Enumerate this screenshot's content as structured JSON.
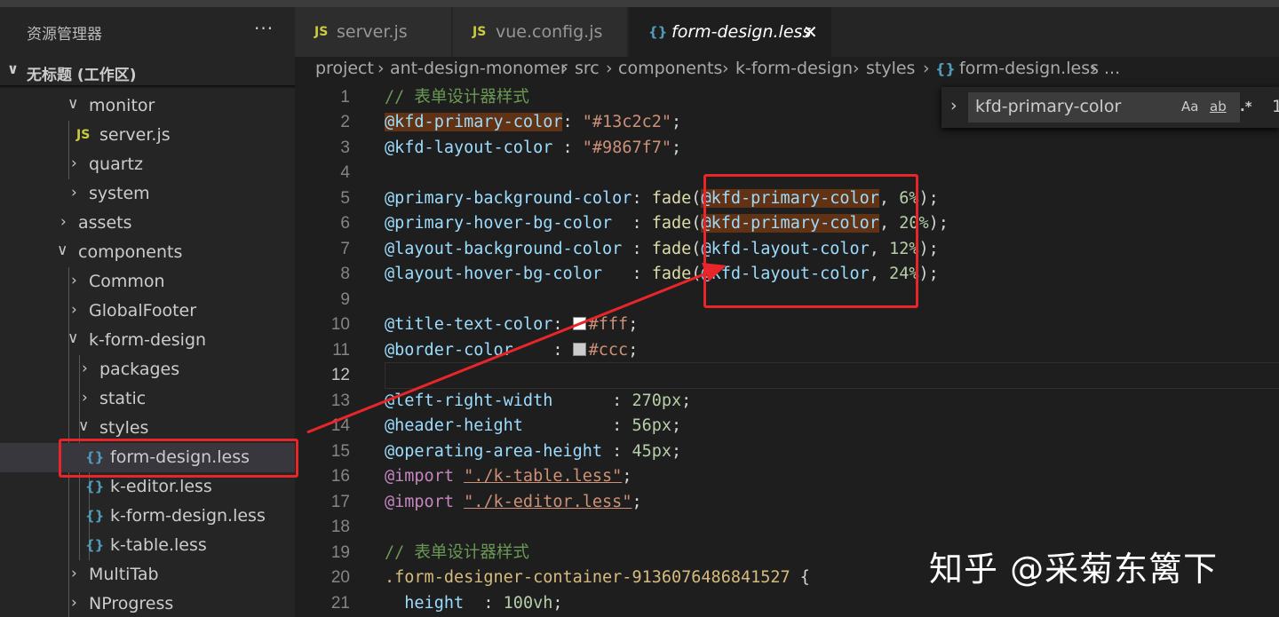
{
  "sidebar": {
    "header": "资源管理器",
    "more": "···",
    "workspace": "无标题 (工作区)",
    "items": [
      {
        "label": "monitor",
        "kind": "folder-open"
      },
      {
        "label": "server.js",
        "kind": "js"
      },
      {
        "label": "quartz",
        "kind": "folder"
      },
      {
        "label": "system",
        "kind": "folder"
      },
      {
        "label": "assets",
        "kind": "folder"
      },
      {
        "label": "components",
        "kind": "folder-open"
      },
      {
        "label": "Common",
        "kind": "folder"
      },
      {
        "label": "GlobalFooter",
        "kind": "folder"
      },
      {
        "label": "k-form-design",
        "kind": "folder-open"
      },
      {
        "label": "packages",
        "kind": "folder"
      },
      {
        "label": "static",
        "kind": "folder"
      },
      {
        "label": "styles",
        "kind": "folder-open"
      },
      {
        "label": "form-design.less",
        "kind": "less"
      },
      {
        "label": "k-editor.less",
        "kind": "less"
      },
      {
        "label": "k-form-design.less",
        "kind": "less"
      },
      {
        "label": "k-table.less",
        "kind": "less"
      },
      {
        "label": "MultiTab",
        "kind": "folder"
      },
      {
        "label": "NProgress",
        "kind": "folder"
      }
    ]
  },
  "icons": {
    "js": "JS",
    "less": "{}",
    "chevron_right": "›",
    "chevron_down": "⌄",
    "close": "✕"
  },
  "tabs": [
    {
      "label": "server.js",
      "icon": "JS"
    },
    {
      "label": "vue.config.js",
      "icon": "JS"
    },
    {
      "label": "form-design.less",
      "icon": "{}",
      "active": true
    }
  ],
  "breadcrumb": [
    "project",
    "ant-design-monomer",
    "src",
    "components",
    "k-form-design",
    "styles",
    "form-design.less",
    "..."
  ],
  "find": {
    "value": "kfd-primary-color",
    "match_case": "Aa",
    "whole_word": "ab",
    "regex": ".*",
    "count": "1"
  },
  "code_lines": [
    "1",
    "2",
    "3",
    "4",
    "5",
    "6",
    "7",
    "8",
    "9",
    "10",
    "11",
    "12",
    "13",
    "14",
    "15",
    "16",
    "17",
    "18",
    "19",
    "20",
    "21"
  ],
  "code": {
    "l1_comment": "// 表单设计器样式",
    "l2_var": "@kfd-primary-color",
    "l2_val": "\"#13c2c2\"",
    "l3_var": "@kfd-layout-color",
    "l3_val": "\"#9867f7\"",
    "l5_var": "@primary-background-color",
    "l6_var": "@primary-hover-bg-color",
    "l7_var": "@layout-background-color",
    "l8_var": "@layout-hover-bg-color",
    "fade": "fade",
    "kfd_primary": "@kfd-primary-color",
    "kfd_layout": "@kfd-layout-color",
    "p6": "6%",
    "p20": "20%",
    "p12": "12%",
    "p24": "24%",
    "l10_var": "@title-text-color",
    "l10_val": "#fff",
    "l11_var": "@border-color",
    "l11_val": "#ccc",
    "l13_var": "@left-right-width",
    "l13_val": "270px",
    "l14_var": "@header-height",
    "l14_val": "56px",
    "l15_var": "@operating-area-height",
    "l15_val": "45px",
    "import": "@import",
    "l16_path": "\"./k-table.less\"",
    "l17_path": "\"./k-editor.less\"",
    "l19_comment": "// 表单设计器样式",
    "l20_class": ".form-designer-container-9136076486841527",
    "l21_prop": "height",
    "l21_val": "100vh"
  },
  "swatch_colors": {
    "fff": "#ffffff",
    "ccc": "#cccccc"
  },
  "annotation_color": "#e8262a",
  "watermark": "知乎 @采菊东篱下"
}
